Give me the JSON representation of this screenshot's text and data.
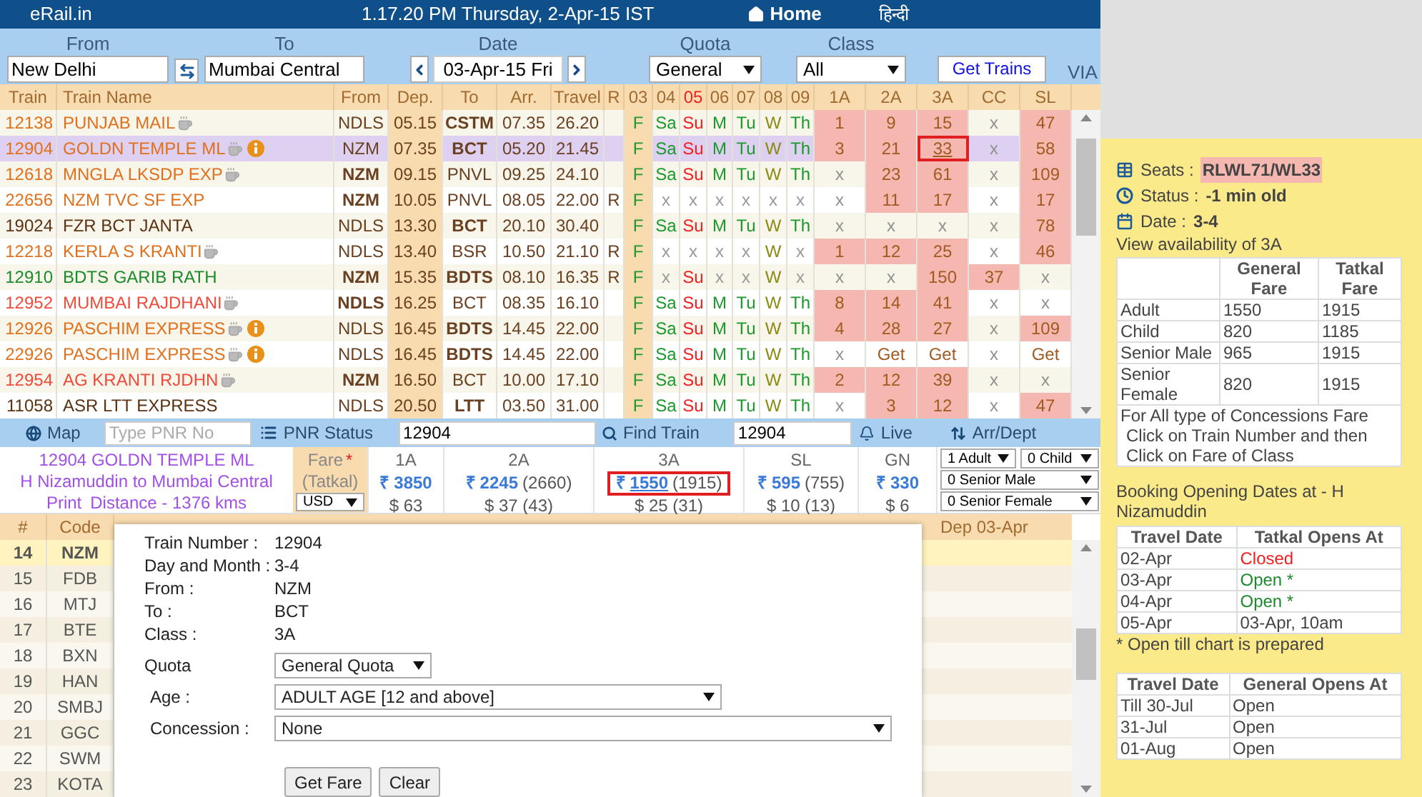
{
  "header": {
    "logo": "eRail.in",
    "datetime": "1.17.20 PM Thursday, 2-Apr-15 IST",
    "home": "Home",
    "language": "हिन्दी"
  },
  "search": {
    "from_label": "From",
    "from": "New Delhi",
    "to_label": "To",
    "to": "Mumbai Central",
    "date_label": "Date",
    "date": "03-Apr-15 Fri",
    "quota_label": "Quota",
    "quota": "General",
    "class_label": "Class",
    "class": "All",
    "submit": "Get Trains",
    "via": "VIA"
  },
  "table": {
    "columns": [
      "Train",
      "Train Name",
      "From",
      "Dep.",
      "To",
      "Arr.",
      "Travel",
      "R"
    ],
    "day_columns": [
      {
        "label": "03",
        "holiday": false,
        "color": "#1a9a2a"
      },
      {
        "label": "04",
        "holiday": false,
        "color": "#1a9a2a"
      },
      {
        "label": "05",
        "holiday": true,
        "color": "#f02020"
      },
      {
        "label": "06",
        "holiday": false,
        "color": "#1a9a2a"
      },
      {
        "label": "07",
        "holiday": false,
        "color": "#1a9a2a"
      },
      {
        "label": "08",
        "holiday": false,
        "color": "#8a8a10"
      },
      {
        "label": "09",
        "holiday": false,
        "color": "#1a9a2a"
      }
    ],
    "class_columns": [
      "1A",
      "2A",
      "3A",
      "CC",
      "SL"
    ],
    "rows": [
      {
        "number": "12138",
        "name": "PUNJAB MAIL",
        "color": "#e0701c",
        "pantry": true,
        "info": false,
        "selected": false,
        "from": "NDLS",
        "from_bold": false,
        "dep": "05.15",
        "to": "CSTM",
        "to_bold": true,
        "arr": "07.35",
        "travel": "26.20",
        "days": [
          "F",
          "Sa",
          "Su",
          "M",
          "Tu",
          "W",
          "Th"
        ],
        "runs": [
          true,
          true,
          true,
          true,
          true,
          true,
          true
        ],
        "classes": [
          {
            "text": "1",
            "kind": "seats",
            "selected": false
          },
          {
            "text": "9",
            "kind": "seats",
            "selected": false
          },
          {
            "text": "15",
            "kind": "seats",
            "selected": false
          },
          {
            "text": "x",
            "kind": "none",
            "selected": false
          },
          {
            "text": "47",
            "kind": "seats",
            "selected": false
          }
        ]
      },
      {
        "number": "12904",
        "name": "GOLDN TEMPLE ML",
        "color": "#e0701c",
        "pantry": true,
        "info": true,
        "selected": true,
        "from": "NZM",
        "from_bold": false,
        "dep": "07.35",
        "to": "BCT",
        "to_bold": true,
        "arr": "05.20",
        "travel": "21.45",
        "days": [
          "F",
          "Sa",
          "Su",
          "M",
          "Tu",
          "W",
          "Th"
        ],
        "runs": [
          true,
          true,
          true,
          true,
          true,
          true,
          true
        ],
        "classes": [
          {
            "text": "3",
            "kind": "seats",
            "selected": false
          },
          {
            "text": "21",
            "kind": "seats",
            "selected": false
          },
          {
            "text": "33",
            "kind": "seats",
            "selected": true
          },
          {
            "text": "x",
            "kind": "none",
            "selected": false
          },
          {
            "text": "58",
            "kind": "seats",
            "selected": false
          }
        ]
      },
      {
        "number": "12618",
        "name": "MNGLA LKSDP EXP",
        "color": "#e0701c",
        "pantry": true,
        "info": false,
        "selected": false,
        "from": "NZM",
        "from_bold": true,
        "dep": "09.15",
        "to": "PNVL",
        "to_bold": false,
        "arr": "09.25",
        "travel": "24.10",
        "days": [
          "F",
          "Sa",
          "Su",
          "M",
          "Tu",
          "W",
          "Th"
        ],
        "runs": [
          true,
          true,
          true,
          true,
          true,
          true,
          true
        ],
        "classes": [
          {
            "text": "x",
            "kind": "none",
            "selected": false
          },
          {
            "text": "23",
            "kind": "seats",
            "selected": false
          },
          {
            "text": "61",
            "kind": "seats",
            "selected": false
          },
          {
            "text": "x",
            "kind": "none",
            "selected": false
          },
          {
            "text": "109",
            "kind": "seats",
            "selected": false
          }
        ]
      },
      {
        "number": "22656",
        "name": "NZM TVC SF EXP",
        "color": "#e0701c",
        "pantry": false,
        "info": false,
        "selected": false,
        "from": "NZM",
        "from_bold": true,
        "dep": "10.05",
        "to": "PNVL",
        "to_bold": false,
        "arr": "08.05",
        "travel": "22.00",
        "r": "R",
        "days": [
          "F",
          "x",
          "x",
          "x",
          "x",
          "x",
          "x"
        ],
        "runs": [
          true,
          false,
          false,
          false,
          false,
          false,
          false
        ],
        "classes": [
          {
            "text": "x",
            "kind": "none",
            "selected": false
          },
          {
            "text": "11",
            "kind": "seats",
            "selected": false
          },
          {
            "text": "17",
            "kind": "seats",
            "selected": false
          },
          {
            "text": "x",
            "kind": "none",
            "selected": false
          },
          {
            "text": "17",
            "kind": "seats",
            "selected": false
          }
        ]
      },
      {
        "number": "19024",
        "name": "FZR BCT JANTA",
        "color": "#5a3212",
        "pantry": false,
        "info": false,
        "selected": false,
        "from": "NDLS",
        "from_bold": false,
        "dep": "13.30",
        "to": "BCT",
        "to_bold": true,
        "arr": "20.10",
        "travel": "30.40",
        "days": [
          "F",
          "Sa",
          "Su",
          "M",
          "Tu",
          "W",
          "Th"
        ],
        "runs": [
          true,
          true,
          true,
          true,
          true,
          true,
          true
        ],
        "classes": [
          {
            "text": "x",
            "kind": "none",
            "selected": false
          },
          {
            "text": "x",
            "kind": "none",
            "selected": false
          },
          {
            "text": "x",
            "kind": "none",
            "selected": false
          },
          {
            "text": "x",
            "kind": "none",
            "selected": false
          },
          {
            "text": "78",
            "kind": "seats",
            "selected": false
          }
        ]
      },
      {
        "number": "12218",
        "name": "KERLA S KRANTI",
        "color": "#e0701c",
        "pantry": true,
        "info": false,
        "selected": false,
        "from": "NDLS",
        "from_bold": false,
        "dep": "13.40",
        "to": "BSR",
        "to_bold": false,
        "arr": "10.50",
        "travel": "21.10",
        "r": "R",
        "days": [
          "F",
          "x",
          "x",
          "x",
          "x",
          "W",
          "x"
        ],
        "runs": [
          true,
          false,
          false,
          false,
          false,
          true,
          false
        ],
        "classes": [
          {
            "text": "1",
            "kind": "seats",
            "selected": false
          },
          {
            "text": "12",
            "kind": "seats",
            "selected": false
          },
          {
            "text": "25",
            "kind": "seats",
            "selected": false
          },
          {
            "text": "x",
            "kind": "none",
            "selected": false
          },
          {
            "text": "46",
            "kind": "seats",
            "selected": false
          }
        ]
      },
      {
        "number": "12910",
        "name": "BDTS GARIB RATH",
        "color": "#1a8a2a",
        "pantry": false,
        "info": false,
        "selected": false,
        "from": "NZM",
        "from_bold": true,
        "dep": "15.35",
        "to": "BDTS",
        "to_bold": true,
        "arr": "08.10",
        "travel": "16.35",
        "r": "R",
        "days": [
          "F",
          "x",
          "Su",
          "x",
          "x",
          "W",
          "x"
        ],
        "runs": [
          true,
          false,
          true,
          false,
          false,
          true,
          false
        ],
        "classes": [
          {
            "text": "x",
            "kind": "none",
            "selected": false
          },
          {
            "text": "x",
            "kind": "none",
            "selected": false
          },
          {
            "text": "150",
            "kind": "seats",
            "selected": false
          },
          {
            "text": "37",
            "kind": "seats",
            "selected": false
          },
          {
            "text": "x",
            "kind": "none",
            "selected": false
          }
        ]
      },
      {
        "number": "12952",
        "name": "MUMBAI RAJDHANI",
        "color": "#f04a3a",
        "pantry": true,
        "info": false,
        "selected": false,
        "from": "NDLS",
        "from_bold": true,
        "dep": "16.25",
        "to": "BCT",
        "to_bold": false,
        "arr": "08.35",
        "travel": "16.10",
        "days": [
          "F",
          "Sa",
          "Su",
          "M",
          "Tu",
          "W",
          "Th"
        ],
        "runs": [
          true,
          true,
          true,
          true,
          true,
          true,
          true
        ],
        "classes": [
          {
            "text": "8",
            "kind": "seats",
            "selected": false
          },
          {
            "text": "14",
            "kind": "seats",
            "selected": false
          },
          {
            "text": "41",
            "kind": "seats",
            "selected": false
          },
          {
            "text": "x",
            "kind": "none",
            "selected": false
          },
          {
            "text": "x",
            "kind": "none",
            "selected": false
          }
        ]
      },
      {
        "number": "12926",
        "name": "PASCHIM EXPRESS",
        "color": "#e0701c",
        "pantry": true,
        "info": true,
        "selected": false,
        "from": "NDLS",
        "from_bold": false,
        "dep": "16.45",
        "to": "BDTS",
        "to_bold": true,
        "arr": "14.45",
        "travel": "22.00",
        "days": [
          "F",
          "Sa",
          "Su",
          "M",
          "Tu",
          "W",
          "Th"
        ],
        "runs": [
          true,
          true,
          true,
          true,
          true,
          true,
          true
        ],
        "classes": [
          {
            "text": "4",
            "kind": "seats",
            "selected": false
          },
          {
            "text": "28",
            "kind": "seats",
            "selected": false
          },
          {
            "text": "27",
            "kind": "seats",
            "selected": false
          },
          {
            "text": "x",
            "kind": "none",
            "selected": false
          },
          {
            "text": "109",
            "kind": "seats",
            "selected": false
          }
        ]
      },
      {
        "number": "22926",
        "name": "PASCHIM EXPRESS",
        "color": "#e0701c",
        "pantry": true,
        "info": true,
        "selected": false,
        "from": "NDLS",
        "from_bold": false,
        "dep": "16.45",
        "to": "BDTS",
        "to_bold": true,
        "arr": "14.45",
        "travel": "22.00",
        "days": [
          "F",
          "Sa",
          "Su",
          "M",
          "Tu",
          "W",
          "Th"
        ],
        "runs": [
          true,
          true,
          true,
          true,
          true,
          true,
          true
        ],
        "classes": [
          {
            "text": "x",
            "kind": "none",
            "selected": false
          },
          {
            "text": "Get",
            "kind": "get",
            "selected": false
          },
          {
            "text": "Get",
            "kind": "get",
            "selected": false
          },
          {
            "text": "x",
            "kind": "none",
            "selected": false
          },
          {
            "text": "Get",
            "kind": "get",
            "selected": false
          }
        ]
      },
      {
        "number": "12954",
        "name": "AG KRANTI RJDHN",
        "color": "#f04a3a",
        "pantry": true,
        "info": false,
        "selected": false,
        "from": "NZM",
        "from_bold": true,
        "dep": "16.50",
        "to": "BCT",
        "to_bold": false,
        "arr": "10.00",
        "travel": "17.10",
        "days": [
          "F",
          "Sa",
          "Su",
          "M",
          "Tu",
          "W",
          "Th"
        ],
        "runs": [
          true,
          true,
          true,
          true,
          true,
          true,
          true
        ],
        "classes": [
          {
            "text": "2",
            "kind": "seats",
            "selected": false
          },
          {
            "text": "12",
            "kind": "seats",
            "selected": false
          },
          {
            "text": "39",
            "kind": "seats",
            "selected": false
          },
          {
            "text": "x",
            "kind": "none",
            "selected": false
          },
          {
            "text": "x",
            "kind": "none",
            "selected": false
          }
        ]
      },
      {
        "number": "11058",
        "name": "ASR LTT EXPRESS",
        "color": "#5a3212",
        "pantry": false,
        "info": false,
        "selected": false,
        "from": "NDLS",
        "from_bold": false,
        "dep": "20.50",
        "to": "LTT",
        "to_bold": true,
        "arr": "03.50",
        "travel": "31.00",
        "days": [
          "F",
          "Sa",
          "Su",
          "M",
          "Tu",
          "W",
          "Th"
        ],
        "runs": [
          true,
          true,
          true,
          true,
          true,
          true,
          true
        ],
        "classes": [
          {
            "text": "x",
            "kind": "none",
            "selected": false
          },
          {
            "text": "3",
            "kind": "seats",
            "selected": false
          },
          {
            "text": "12",
            "kind": "seats",
            "selected": false
          },
          {
            "text": "x",
            "kind": "none",
            "selected": false
          },
          {
            "text": "47",
            "kind": "seats",
            "selected": false
          }
        ]
      }
    ]
  },
  "toolbar": {
    "map": "Map",
    "pnr_placeholder": "Type PNR No",
    "pnr_status": "PNR Status",
    "find_value": "12904",
    "find_train": "Find Train",
    "live_value": "12904",
    "live": "Live",
    "arr_dept": "Arr/Dept"
  },
  "fare": {
    "train": "12904 GOLDN TEMPLE ML",
    "route": "H Nizamuddin to Mumbai Central",
    "print": "Print",
    "distance": "Distance - 1376 kms",
    "fare_label": "Fare",
    "fare_mark": "*",
    "tatkal_label": "(Tatkal)",
    "currency": "USD",
    "symbol": "₹",
    "classes": [
      {
        "class": "1A",
        "fare": "3850",
        "usd": "$ 63",
        "selected": false
      },
      {
        "class": "2A",
        "fare": "2245",
        "tatkal": "(2660)",
        "usd": "$ 37 (43)",
        "selected": false
      },
      {
        "class": "3A",
        "fare": "1550",
        "tatkal": "(1915)",
        "usd": "$ 25 (31)",
        "selected": true
      },
      {
        "class": "SL",
        "fare": "595",
        "tatkal": "(755)",
        "usd": "$ 10 (13)",
        "selected": false
      },
      {
        "class": "GN",
        "fare": "330",
        "usd": "$ 6",
        "selected": false
      }
    ],
    "passengers": [
      "1 Adult",
      "0 Child",
      "0 Senior Male",
      "0 Senior Female"
    ]
  },
  "stations": {
    "columns": [
      "#",
      "Code",
      "Dep 03-Apr"
    ],
    "rows": [
      {
        "no": "14",
        "code": "NZM",
        "selected": true
      },
      {
        "no": "15",
        "code": "FDB",
        "selected": false
      },
      {
        "no": "16",
        "code": "MTJ",
        "selected": false
      },
      {
        "no": "17",
        "code": "BTE",
        "selected": false
      },
      {
        "no": "18",
        "code": "BXN",
        "selected": false
      },
      {
        "no": "19",
        "code": "HAN",
        "selected": false
      },
      {
        "no": "20",
        "code": "SMBJ",
        "selected": false
      },
      {
        "no": "21",
        "code": "GGC",
        "selected": false
      },
      {
        "no": "22",
        "code": "SWM",
        "selected": false
      },
      {
        "no": "23",
        "code": "KOTA",
        "selected": false
      }
    ]
  },
  "fare_form": {
    "info": [
      {
        "label": "Train Number :",
        "value": "12904"
      },
      {
        "label": "Day and Month :",
        "value": "3-4"
      },
      {
        "label": "From :",
        "value": "NZM"
      },
      {
        "label": "To :",
        "value": "BCT"
      },
      {
        "label": "Class :",
        "value": "3A"
      }
    ],
    "quota_label": "Quota",
    "quota": "General Quota",
    "age_label": "Age :",
    "age": "ADULT AGE [12 and above]",
    "concession_label": "Concession :",
    "concession": "None",
    "buttons": [
      "Get Fare",
      "Clear"
    ]
  },
  "side": {
    "seats_label": "Seats :",
    "seats": "RLWL71/WL33",
    "status_label": "Status :",
    "status": "-1 min old",
    "date_label": "Date :",
    "date": "3-4",
    "view": "View availability of 3A",
    "fare_table": {
      "columns": [
        "",
        "General Fare",
        "Tatkal Fare"
      ],
      "rows": [
        [
          "Adult",
          "1550",
          "1915"
        ],
        [
          "Child",
          "820",
          "1185"
        ],
        [
          "Senior Male",
          "965",
          "1915"
        ],
        [
          "Senior Female",
          "820",
          "1915"
        ]
      ],
      "note": [
        "For All type of Concessions Fare",
        "Click on Train Number and then",
        "Click on Fare of Class"
      ]
    },
    "booking_title": "Booking Opening Dates at - H Nizamuddin",
    "tatkal_table": {
      "columns": [
        "Travel Date",
        "Tatkal Opens At"
      ],
      "rows": [
        {
          "date": "02-Apr",
          "opens": "Closed",
          "kind": "closed"
        },
        {
          "date": "03-Apr",
          "opens": "Open *",
          "kind": "open"
        },
        {
          "date": "04-Apr",
          "opens": "Open *",
          "kind": "open"
        },
        {
          "date": "05-Apr",
          "opens": "03-Apr, 10am",
          "kind": "time"
        }
      ]
    },
    "tatkal_note": "* Open till chart is prepared",
    "general_table": {
      "columns": [
        "Travel Date",
        "General Opens At"
      ],
      "rows": [
        [
          "Till 30-Jul",
          "Open"
        ],
        [
          "31-Jul",
          "Open"
        ],
        [
          "01-Aug",
          "Open"
        ]
      ]
    }
  }
}
